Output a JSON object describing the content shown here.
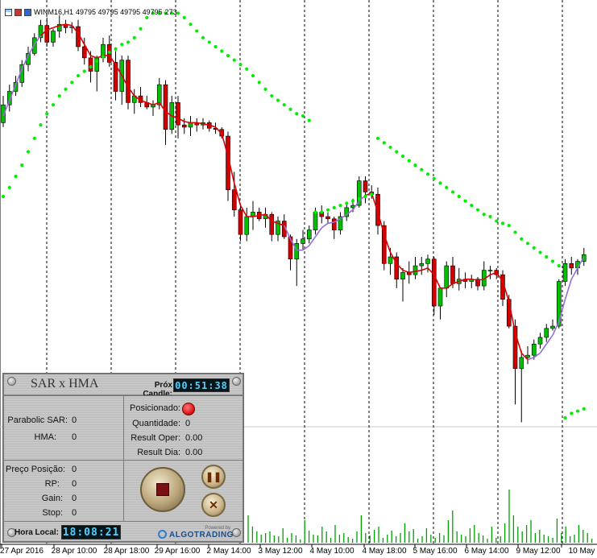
{
  "chart_header": {
    "symbol": "WINM16,H1",
    "ohlc": "49795 49795 49795 49795",
    "volume": "273"
  },
  "colors": {
    "bull": "#00c000",
    "bear": "#d00000",
    "sar": "#00ee00",
    "hma_up": "#9370db",
    "hma_down": "#e00000",
    "volume": "#00a000",
    "panel_lcd": "#4fd2ff",
    "record_dot": "#e21b1b"
  },
  "x_axis_labels": [
    "27 Apr 2016",
    "28 Apr 10:00",
    "28 Apr 18:00",
    "29 Apr 16:00",
    "2 May 14:00",
    "3 May 12:00",
    "4 May 10:00",
    "4 May 18:00",
    "5 May 16:00",
    "6 May 14:00",
    "9 May 12:00",
    "10 May"
  ],
  "chart_data": {
    "type": "candlestick",
    "symbol": "WINM16",
    "timeframe": "H1",
    "ylim": [
      48940,
      50820
    ],
    "candles": [
      {
        "o": 50300,
        "h": 50420,
        "l": 50280,
        "c": 50380
      },
      {
        "o": 50380,
        "h": 50470,
        "l": 50350,
        "c": 50440
      },
      {
        "o": 50440,
        "h": 50510,
        "l": 50420,
        "c": 50480
      },
      {
        "o": 50480,
        "h": 50580,
        "l": 50460,
        "c": 50560
      },
      {
        "o": 50560,
        "h": 50640,
        "l": 50530,
        "c": 50610
      },
      {
        "o": 50610,
        "h": 50700,
        "l": 50600,
        "c": 50680
      },
      {
        "o": 50680,
        "h": 50760,
        "l": 50660,
        "c": 50735
      },
      {
        "o": 50735,
        "h": 50770,
        "l": 50640,
        "c": 50660
      },
      {
        "o": 50660,
        "h": 50720,
        "l": 50640,
        "c": 50710
      },
      {
        "o": 50710,
        "h": 50780,
        "l": 50680,
        "c": 50740
      },
      {
        "o": 50740,
        "h": 50760,
        "l": 50700,
        "c": 50725
      },
      {
        "o": 50725,
        "h": 50750,
        "l": 50700,
        "c": 50730
      },
      {
        "o": 50730,
        "h": 50760,
        "l": 50620,
        "c": 50640
      },
      {
        "o": 50640,
        "h": 50680,
        "l": 50560,
        "c": 50590
      },
      {
        "o": 50590,
        "h": 50620,
        "l": 50480,
        "c": 50530
      },
      {
        "o": 50530,
        "h": 50600,
        "l": 50440,
        "c": 50590
      },
      {
        "o": 50590,
        "h": 50680,
        "l": 50570,
        "c": 50650
      },
      {
        "o": 50650,
        "h": 50690,
        "l": 50550,
        "c": 50570
      },
      {
        "o": 50570,
        "h": 50620,
        "l": 50400,
        "c": 50440
      },
      {
        "o": 50440,
        "h": 50600,
        "l": 50380,
        "c": 50580
      },
      {
        "o": 50580,
        "h": 50600,
        "l": 50360,
        "c": 50390
      },
      {
        "o": 50390,
        "h": 50450,
        "l": 50340,
        "c": 50420
      },
      {
        "o": 50420,
        "h": 50460,
        "l": 50370,
        "c": 50390
      },
      {
        "o": 50390,
        "h": 50420,
        "l": 50360,
        "c": 50370
      },
      {
        "o": 50370,
        "h": 50400,
        "l": 50330,
        "c": 50380
      },
      {
        "o": 50380,
        "h": 50500,
        "l": 50360,
        "c": 50470
      },
      {
        "o": 50470,
        "h": 50490,
        "l": 50200,
        "c": 50270
      },
      {
        "o": 50270,
        "h": 50420,
        "l": 50250,
        "c": 50390
      },
      {
        "o": 50390,
        "h": 50420,
        "l": 50230,
        "c": 50290
      },
      {
        "o": 50290,
        "h": 50320,
        "l": 50250,
        "c": 50280
      },
      {
        "o": 50280,
        "h": 50330,
        "l": 50240,
        "c": 50300
      },
      {
        "o": 50300,
        "h": 50320,
        "l": 50260,
        "c": 50290
      },
      {
        "o": 50290,
        "h": 50320,
        "l": 50270,
        "c": 50300
      },
      {
        "o": 50300,
        "h": 50310,
        "l": 50260,
        "c": 50275
      },
      {
        "o": 50275,
        "h": 50300,
        "l": 50250,
        "c": 50270
      },
      {
        "o": 50270,
        "h": 50280,
        "l": 50230,
        "c": 50240
      },
      {
        "o": 50240,
        "h": 50260,
        "l": 49950,
        "c": 50000
      },
      {
        "o": 50000,
        "h": 50080,
        "l": 49880,
        "c": 49910
      },
      {
        "o": 49910,
        "h": 49940,
        "l": 49770,
        "c": 49800
      },
      {
        "o": 49800,
        "h": 49920,
        "l": 49770,
        "c": 49880
      },
      {
        "o": 49880,
        "h": 49950,
        "l": 49820,
        "c": 49900
      },
      {
        "o": 49900,
        "h": 49920,
        "l": 49860,
        "c": 49870
      },
      {
        "o": 49870,
        "h": 49920,
        "l": 49830,
        "c": 49890
      },
      {
        "o": 49890,
        "h": 49900,
        "l": 49770,
        "c": 49800
      },
      {
        "o": 49800,
        "h": 49880,
        "l": 49770,
        "c": 49860
      },
      {
        "o": 49860,
        "h": 49890,
        "l": 49780,
        "c": 49790
      },
      {
        "o": 49790,
        "h": 49800,
        "l": 49640,
        "c": 49690
      },
      {
        "o": 49690,
        "h": 49780,
        "l": 49570,
        "c": 49760
      },
      {
        "o": 49760,
        "h": 49820,
        "l": 49730,
        "c": 49780
      },
      {
        "o": 49780,
        "h": 49840,
        "l": 49760,
        "c": 49820
      },
      {
        "o": 49820,
        "h": 49920,
        "l": 49800,
        "c": 49900
      },
      {
        "o": 49900,
        "h": 49930,
        "l": 49850,
        "c": 49880
      },
      {
        "o": 49880,
        "h": 49900,
        "l": 49850,
        "c": 49870
      },
      {
        "o": 49870,
        "h": 49880,
        "l": 49780,
        "c": 49820
      },
      {
        "o": 49820,
        "h": 49900,
        "l": 49800,
        "c": 49880
      },
      {
        "o": 49880,
        "h": 49940,
        "l": 49860,
        "c": 49920
      },
      {
        "o": 49920,
        "h": 49960,
        "l": 49900,
        "c": 49930
      },
      {
        "o": 49930,
        "h": 50060,
        "l": 49920,
        "c": 50040
      },
      {
        "o": 50040,
        "h": 50060,
        "l": 49940,
        "c": 49990
      },
      {
        "o": 49990,
        "h": 50020,
        "l": 49960,
        "c": 49980
      },
      {
        "o": 49980,
        "h": 50010,
        "l": 49800,
        "c": 49840
      },
      {
        "o": 49840,
        "h": 49860,
        "l": 49640,
        "c": 49670
      },
      {
        "o": 49670,
        "h": 49740,
        "l": 49620,
        "c": 49700
      },
      {
        "o": 49700,
        "h": 49720,
        "l": 49560,
        "c": 49600
      },
      {
        "o": 49600,
        "h": 49650,
        "l": 49500,
        "c": 49630
      },
      {
        "o": 49630,
        "h": 49680,
        "l": 49580,
        "c": 49620
      },
      {
        "o": 49620,
        "h": 49700,
        "l": 49600,
        "c": 49660
      },
      {
        "o": 49660,
        "h": 49700,
        "l": 49620,
        "c": 49670
      },
      {
        "o": 49670,
        "h": 49710,
        "l": 49630,
        "c": 49690
      },
      {
        "o": 49690,
        "h": 49700,
        "l": 49440,
        "c": 49480
      },
      {
        "o": 49480,
        "h": 49500,
        "l": 49420,
        "c": 49560
      },
      {
        "o": 49560,
        "h": 49680,
        "l": 49520,
        "c": 49660
      },
      {
        "o": 49660,
        "h": 49700,
        "l": 49560,
        "c": 49580
      },
      {
        "o": 49580,
        "h": 49650,
        "l": 49550,
        "c": 49600
      },
      {
        "o": 49600,
        "h": 49630,
        "l": 49560,
        "c": 49590
      },
      {
        "o": 49590,
        "h": 49620,
        "l": 49560,
        "c": 49600
      },
      {
        "o": 49600,
        "h": 49610,
        "l": 49550,
        "c": 49570
      },
      {
        "o": 49570,
        "h": 49680,
        "l": 49550,
        "c": 49640
      },
      {
        "o": 49640,
        "h": 49660,
        "l": 49600,
        "c": 49640
      },
      {
        "o": 49640,
        "h": 49650,
        "l": 49600,
        "c": 49620
      },
      {
        "o": 49620,
        "h": 49640,
        "l": 49480,
        "c": 49510
      },
      {
        "o": 49510,
        "h": 49530,
        "l": 49380,
        "c": 49390
      },
      {
        "o": 49390,
        "h": 49420,
        "l": 49040,
        "c": 49200
      },
      {
        "o": 49200,
        "h": 49280,
        "l": 48960,
        "c": 49250
      },
      {
        "o": 49250,
        "h": 49300,
        "l": 49220,
        "c": 49260
      },
      {
        "o": 49260,
        "h": 49330,
        "l": 49240,
        "c": 49310
      },
      {
        "o": 49310,
        "h": 49360,
        "l": 49290,
        "c": 49340
      },
      {
        "o": 49340,
        "h": 49400,
        "l": 49320,
        "c": 49380
      },
      {
        "o": 49380,
        "h": 49420,
        "l": 49370,
        "c": 49390
      },
      {
        "o": 49390,
        "h": 49600,
        "l": 49380,
        "c": 49590
      },
      {
        "o": 49590,
        "h": 49690,
        "l": 49570,
        "c": 49670
      },
      {
        "o": 49670,
        "h": 49700,
        "l": 49620,
        "c": 49650
      },
      {
        "o": 49650,
        "h": 49690,
        "l": 49620,
        "c": 49680
      },
      {
        "o": 49680,
        "h": 49740,
        "l": 49660,
        "c": 49710
      }
    ],
    "parabolic_sar": [
      49970,
      50010,
      50060,
      50110,
      50170,
      50230,
      50290,
      50340,
      50380,
      50420,
      50450,
      50480,
      50510,
      50530,
      50550,
      50575,
      50595,
      50615,
      50630,
      50650,
      50660,
      50680,
      50720,
      50770,
      50790,
      50790,
      50790,
      50790,
      50790,
      50770,
      50740,
      50710,
      50680,
      50660,
      50640,
      50620,
      50600,
      50580,
      50560,
      50540,
      50510,
      50480,
      50450,
      50420,
      50400,
      50380,
      50360,
      50340,
      50330,
      50310,
      49900,
      49900,
      49910,
      49920,
      49930,
      49940,
      49950,
      49960,
      49970,
      49980,
      50230,
      50210,
      50190,
      50170,
      50150,
      50130,
      50110,
      50090,
      50070,
      50050,
      50030,
      50010,
      49990,
      49970,
      49950,
      49930,
      49910,
      49890,
      49880,
      49860,
      49850,
      49840,
      49810,
      49780,
      49760,
      49740,
      49720,
      49700,
      49680,
      49660,
      48980,
      49000,
      49010,
      49020,
      49030
    ],
    "hma": [
      50330,
      50400,
      50470,
      50540,
      50600,
      50650,
      50690,
      50715,
      50725,
      50735,
      50740,
      50735,
      50700,
      50650,
      50600,
      50590,
      50600,
      50600,
      50560,
      50510,
      50460,
      50420,
      50400,
      50390,
      50380,
      50390,
      50350,
      50330,
      50320,
      50305,
      50300,
      50300,
      50295,
      50290,
      50280,
      50250,
      50150,
      50030,
      49930,
      49880,
      49880,
      49885,
      49890,
      49860,
      49850,
      49840,
      49780,
      49730,
      49730,
      49750,
      49790,
      49830,
      49850,
      49855,
      49870,
      49890,
      49910,
      49950,
      49975,
      49985,
      49900,
      49800,
      49720,
      49670,
      49640,
      49630,
      49635,
      49640,
      49650,
      49620,
      49560,
      49560,
      49580,
      49590,
      49600,
      49600,
      49595,
      49600,
      49620,
      49630,
      49590,
      49500,
      49360,
      49270,
      49240,
      49250,
      49270,
      49310,
      49350,
      49410,
      49510,
      49600,
      49650,
      49700
    ],
    "hma_trend": [
      1,
      1,
      1,
      1,
      1,
      1,
      1,
      -1,
      -1,
      -1,
      -1,
      -1,
      -1,
      -1,
      -1,
      -1,
      -1,
      -1,
      -1,
      -1,
      -1,
      -1,
      -1,
      -1,
      -1,
      -1,
      -1,
      -1,
      -1,
      -1,
      -1,
      -1,
      -1,
      -1,
      -1,
      -1,
      -1,
      -1,
      -1,
      -1,
      -1,
      -1,
      -1,
      -1,
      -1,
      -1,
      1,
      1,
      1,
      1,
      1,
      1,
      1,
      1,
      1,
      1,
      1,
      1,
      1,
      -1,
      -1,
      -1,
      -1,
      -1,
      -1,
      -1,
      -1,
      -1,
      -1,
      -1,
      -1,
      -1,
      -1,
      -1,
      -1,
      -1,
      -1,
      -1,
      -1,
      -1,
      -1,
      -1,
      -1,
      -1,
      -1,
      1,
      1,
      1,
      1,
      1,
      1,
      1,
      1,
      1
    ],
    "volume": [
      0,
      0,
      0,
      0,
      0,
      0,
      0,
      0,
      0,
      0,
      0,
      0,
      0,
      0,
      0,
      0,
      0,
      0,
      0,
      0,
      0,
      0,
      0,
      0,
      0,
      0,
      0,
      0,
      0,
      0,
      0,
      0,
      0,
      0,
      0,
      0,
      0,
      0,
      0,
      0,
      0,
      0,
      0,
      0,
      0,
      0,
      0,
      0,
      0,
      0,
      0,
      0,
      0,
      0,
      0,
      0,
      0,
      0,
      0,
      0,
      0,
      0,
      0,
      0,
      0,
      0,
      0,
      0,
      0,
      0,
      0,
      0,
      0,
      0,
      0,
      0,
      0,
      0,
      0,
      0,
      0,
      0,
      0,
      0,
      0,
      0,
      0,
      0,
      0,
      0,
      0,
      0,
      0,
      0
    ],
    "volume_visible": [
      34,
      20,
      14,
      10,
      12,
      14,
      9,
      8,
      18,
      6,
      12,
      9,
      4,
      28,
      15,
      10,
      9,
      20,
      14,
      6,
      22,
      10,
      12,
      7,
      5,
      14,
      34,
      12,
      9,
      16,
      20,
      6,
      10,
      15,
      8,
      12,
      24,
      14,
      17,
      5,
      8,
      18,
      10,
      6,
      12,
      9,
      28,
      40,
      14,
      10,
      8,
      18,
      22,
      12,
      9,
      5,
      20,
      6,
      8,
      24,
      66,
      34,
      20,
      14,
      22,
      28,
      12,
      16,
      10,
      8,
      6,
      30,
      12,
      20,
      8,
      10,
      22,
      16,
      12,
      5
    ],
    "grid": "vertical dashed"
  },
  "panel": {
    "title": "SAR x HMA",
    "next_candle_label": "Próx Candle:",
    "next_candle_time": "00:51:38",
    "parabolic_sar_label": "Parabolic SAR:",
    "parabolic_sar_value": "0",
    "hma_label": "HMA:",
    "hma_value": "0",
    "posicionado_label": "Posicionado:",
    "quantidade_label": "Quantidade:",
    "quantidade_value": "0",
    "result_oper_label": "Result Oper:",
    "result_oper_value": "0.00",
    "result_dia_label": "Result Dia:",
    "result_dia_value": "0.00",
    "preco_posicao_label": "Preço Posição:",
    "preco_posicao_value": "0",
    "rp_label": "RP:",
    "rp_value": "0",
    "gain_label": "Gain:",
    "gain_value": "0",
    "stop_label": "Stop:",
    "stop_value": "0",
    "hora_local_label": "Hora Local:",
    "hora_local_value": "18:08:21",
    "powered_by": "Powered by",
    "brand": "ALGOTRADING"
  }
}
